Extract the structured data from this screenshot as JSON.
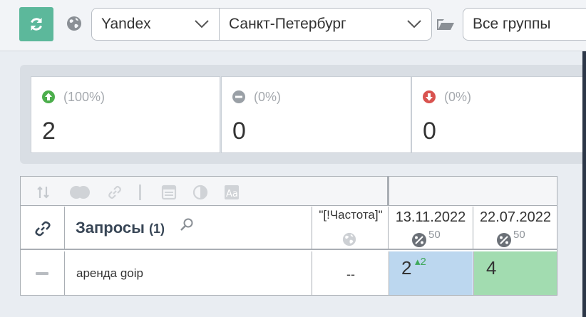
{
  "toolbar": {
    "refresh_icon": "refresh-icon",
    "engine": "Yandex",
    "region": "Санкт-Петербург",
    "groups": "Все группы"
  },
  "stats": [
    {
      "icon": "arrow-up-circle-icon",
      "percent": "(100%)",
      "value": "2",
      "color": "#4cae4c"
    },
    {
      "icon": "minus-circle-icon",
      "percent": "(0%)",
      "value": "0",
      "color": "#9aa0a6"
    },
    {
      "icon": "arrow-down-circle-icon",
      "percent": "(0%)",
      "value": "0",
      "color": "#d9534f"
    }
  ],
  "table": {
    "queries_title": "Запросы",
    "queries_count": "(1)",
    "freq_header": "\"[!Частота]\"",
    "dates": [
      {
        "date": "13.11.2022",
        "pct": "50"
      },
      {
        "date": "22.07.2022",
        "pct": "50"
      }
    ],
    "rows": [
      {
        "query": "аренда goip",
        "frequency": "--",
        "positions": [
          "2",
          "4"
        ],
        "delta": "2"
      }
    ]
  },
  "colors": {
    "accent": "#5cb89b",
    "pos_blue": "#bcd7ef",
    "pos_green": "#a2dcb0"
  }
}
